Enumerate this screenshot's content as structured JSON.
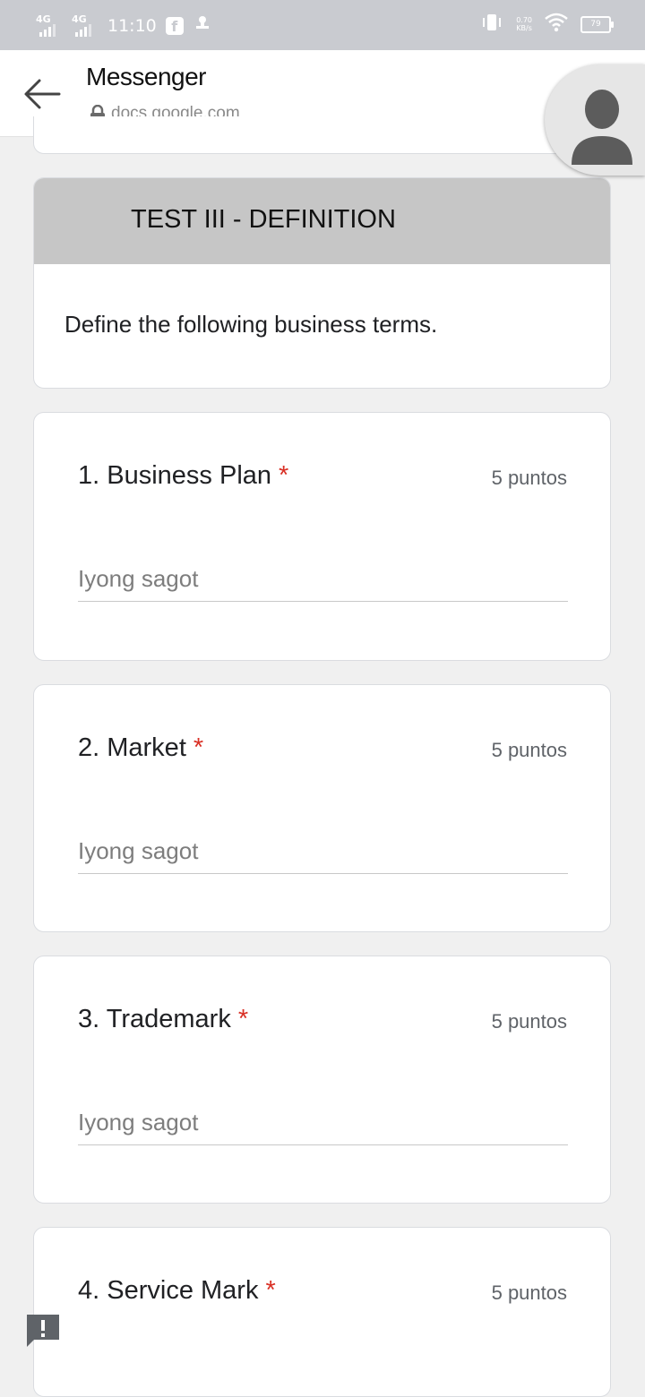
{
  "status_bar": {
    "time": "11:10",
    "signal1_label": "4G",
    "signal2_label": "4G",
    "app_icon_label": "f",
    "net_speed_value": "0.70",
    "net_speed_unit": "KB/s",
    "battery_level": "79"
  },
  "header": {
    "title": "Messenger",
    "url": "docs.google.com"
  },
  "section": {
    "title": "TEST III - DEFINITION",
    "description": "Define the following business terms."
  },
  "questions": [
    {
      "title": "1. Business Plan",
      "required_mark": "*",
      "points": "5 puntos",
      "placeholder": "Iyong sagot"
    },
    {
      "title": "2. Market",
      "required_mark": "*",
      "points": "5 puntos",
      "placeholder": "Iyong sagot"
    },
    {
      "title": "3. Trademark",
      "required_mark": "*",
      "points": "5 puntos",
      "placeholder": "Iyong sagot"
    },
    {
      "title": "4. Service Mark",
      "required_mark": "*",
      "points": "5 puntos"
    }
  ],
  "colors": {
    "required": "#d93025",
    "section_header_bg": "#c6c6c6",
    "page_bg": "#f0f0f0"
  }
}
